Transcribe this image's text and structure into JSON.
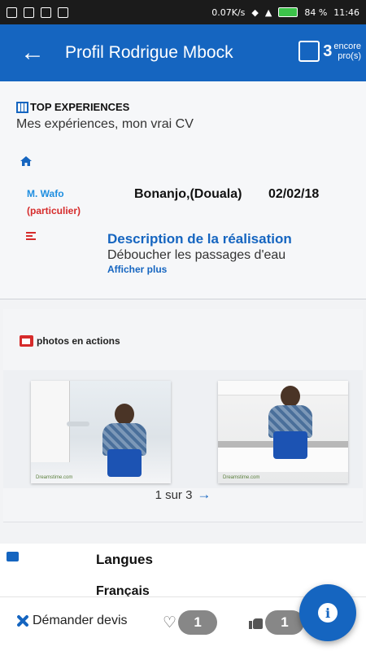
{
  "statusbar": {
    "speed": "0.07K/s",
    "battery": "84 %",
    "time": "11:46"
  },
  "appbar": {
    "title": "Profil Rodrigue Mbock",
    "counter": "3",
    "counter_label_1": "encore",
    "counter_label_2": "pro(s)"
  },
  "experience": {
    "heading": "TOP EXPERIENCES",
    "subtitle": "Mes expériences, mon vrai CV",
    "client_name": "M. Wafo",
    "client_type": "(particulier)",
    "location": "Bonanjo,(Douala)",
    "date": "02/02/18",
    "description_title": "Description de la réalisation",
    "description_text": "Déboucher les passages d'eau",
    "show_more": "Afficher plus"
  },
  "photos": {
    "heading": "photos en actions",
    "pager": "1 sur 3",
    "watermark": "Dreamstime.com"
  },
  "languages": {
    "heading": "Langues",
    "value": "Français"
  },
  "bottombar": {
    "quote_label": "Démander devis",
    "hearts": "1",
    "likes": "1"
  },
  "colors": {
    "primary": "#1565c0",
    "accent_red": "#d62b2b",
    "link_blue": "#1e8ee0"
  }
}
